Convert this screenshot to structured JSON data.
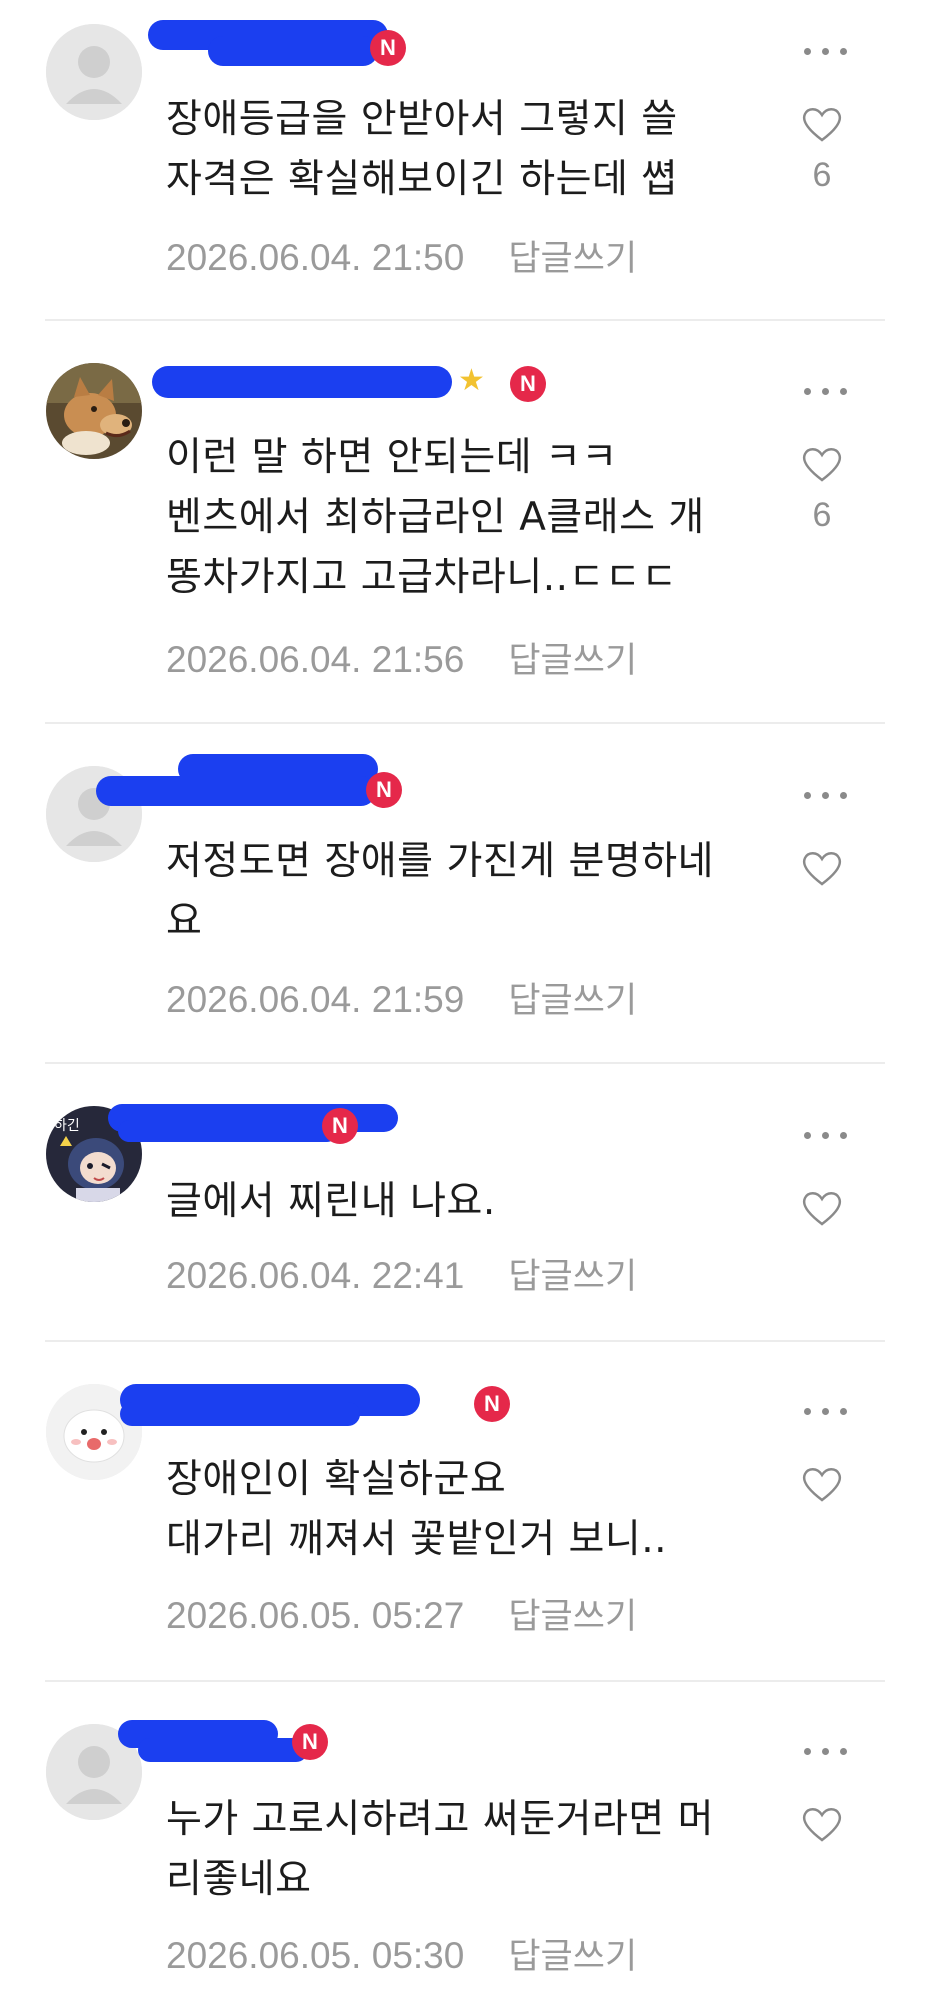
{
  "comments": [
    {
      "avatar": "default-person-icon",
      "badge": "N",
      "has_star": false,
      "text": "장애등급을 안받아서 그렇지 쓸\n자격은 확실해보이긴 하는데 쎱",
      "date": "2026.06.04. 21:50",
      "reply_label": "답글쓰기",
      "likes": "6"
    },
    {
      "avatar": "dog-photo-avatar",
      "badge": "N",
      "has_star": true,
      "text": "이런 말 하면 안되는데 ㅋㅋ\n벤츠에서 최하급라인 A클래스 개\n똥차가지고 고급차라니..ㄷㄷㄷ",
      "date": "2026.06.04. 21:56",
      "reply_label": "답글쓰기",
      "likes": "6"
    },
    {
      "avatar": "default-person-icon",
      "badge": "N",
      "has_star": false,
      "text": "저정도면 장애를 가진게 분명하네\n요",
      "date": "2026.06.04. 21:59",
      "reply_label": "답글쓰기",
      "likes": ""
    },
    {
      "avatar": "anime-character-avatar",
      "badge": "N",
      "has_star": false,
      "text": "글에서 찌린내 나요.",
      "date": "2026.06.04. 22:41",
      "reply_label": "답글쓰기",
      "likes": ""
    },
    {
      "avatar": "white-bear-avatar",
      "badge": "N",
      "has_star": false,
      "text": "장애인이 확실하군요\n대가리 깨져서 꽃밭인거 보니..",
      "date": "2026.06.05. 05:27",
      "reply_label": "답글쓰기",
      "likes": ""
    },
    {
      "avatar": "default-person-icon",
      "badge": "N",
      "has_star": false,
      "text": "누가 고로시하려고 써둔거라면 머\n리좋네요",
      "date": "2026.06.05. 05:30",
      "reply_label": "답글쓰기",
      "likes": ""
    }
  ],
  "colors": {
    "badge": "#e5284a",
    "redaction": "#1b3ff0",
    "meta_text": "#9a9a9a",
    "divider": "#ececec"
  }
}
